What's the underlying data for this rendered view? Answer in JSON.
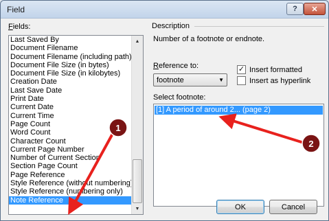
{
  "window": {
    "title": "Field",
    "help_label": "?",
    "close_label": "✕"
  },
  "fields": {
    "label": "Fields:",
    "items": [
      "Last Saved By",
      "Document Filename",
      "Document Filename (including path)",
      "Document File Size (in bytes)",
      "Document File Size (in kilobytes)",
      "Creation Date",
      "Last Save Date",
      "Print Date",
      "Current Date",
      "Current Time",
      "Page Count",
      "Word Count",
      "Character Count",
      "Current Page Number",
      "Number of Current Section",
      "Section Page Count",
      "Page Reference",
      "Style Reference (without numbering)",
      "Style Reference (numbering only)",
      "Note Reference"
    ],
    "selected": "Note Reference"
  },
  "description": {
    "heading": "Description",
    "text": "Number of a footnote or endnote."
  },
  "reference": {
    "label": "Reference to:",
    "value": "footnote"
  },
  "options": {
    "insert_formatted": {
      "label": "Insert formatted",
      "checked": true
    },
    "insert_hyperlink": {
      "label": "Insert as hyperlink",
      "checked": false
    }
  },
  "footnote": {
    "label": "Select footnote:",
    "items": [
      "[1] A period of around 2... (page 2)"
    ]
  },
  "buttons": {
    "ok": "OK",
    "cancel": "Cancel"
  },
  "annotations": {
    "marker1": "1",
    "marker2": "2",
    "arrow_color": "#e8211d",
    "badge_color": "#7a1414"
  },
  "icons": {
    "scroll_up": "▲",
    "scroll_down": "▼",
    "dropdown": "▼",
    "check": "✓"
  }
}
